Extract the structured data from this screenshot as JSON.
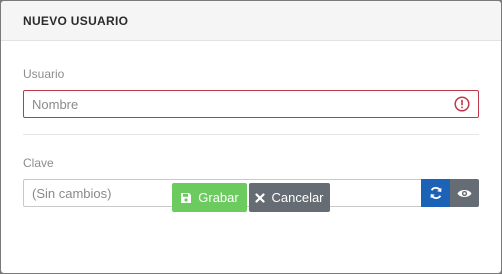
{
  "modal": {
    "title": "NUEVO USUARIO"
  },
  "form": {
    "user": {
      "label": "Usuario",
      "placeholder": "Nombre",
      "error_icon": "exclamation-circle-icon"
    },
    "password": {
      "label": "Clave",
      "placeholder": "(Sin cambios)",
      "refresh_icon": "refresh-icon",
      "show_icon": "eye-icon"
    }
  },
  "actions": {
    "save_label": "Grabar",
    "save_icon": "floppy-disk-icon",
    "cancel_label": "Cancelar",
    "cancel_icon": "x-icon"
  },
  "colors": {
    "error": "#c0394b",
    "primary": "#1c63b8",
    "success": "#6bcb5e",
    "secondary": "#666c73"
  }
}
